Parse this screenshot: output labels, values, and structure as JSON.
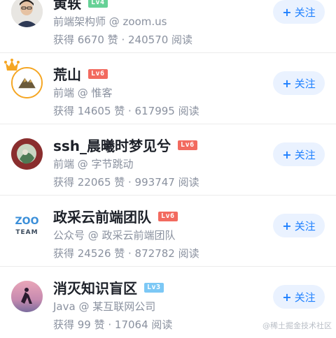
{
  "authors": [
    {
      "name": "黄轶",
      "level": "Lv4",
      "level_class": "lv4",
      "title": "前端架构师 @ zoom.us",
      "stats": "获得 6670 赞 · 240570 阅读",
      "follow_label": "关注",
      "avatar_icon": "person-avatar-icon"
    },
    {
      "name": "荒山",
      "level": "Lv6",
      "level_class": "lv6",
      "title": "前端 @ 惟客",
      "stats": "获得 14605 赞 · 617995 阅读",
      "follow_label": "关注",
      "avatar_icon": "mountain-avatar-icon",
      "crown": true
    },
    {
      "name": "ssh_晨曦时梦见兮",
      "level": "Lv6",
      "level_class": "lv6",
      "title": "前端 @ 字节跳动",
      "stats": "获得 22065 赞 · 993747 阅读",
      "follow_label": "关注",
      "avatar_icon": "illustration-avatar-icon"
    },
    {
      "name": "政采云前端团队",
      "level": "Lv6",
      "level_class": "lv6",
      "title": "公众号 @ 政采云前端团队",
      "stats": "获得 24526 赞 · 872782 阅读",
      "follow_label": "关注",
      "avatar_icon": "zoo-team-logo-icon"
    },
    {
      "name": "消灭知识盲区",
      "level": "Lv3",
      "level_class": "lv3",
      "title": "Java @ 某互联网公司",
      "stats": "获得 99 赞 · 17064 阅读",
      "follow_label": "关注",
      "avatar_icon": "sunset-runner-avatar-icon"
    }
  ],
  "watermark": "@稀土掘金技术社区"
}
